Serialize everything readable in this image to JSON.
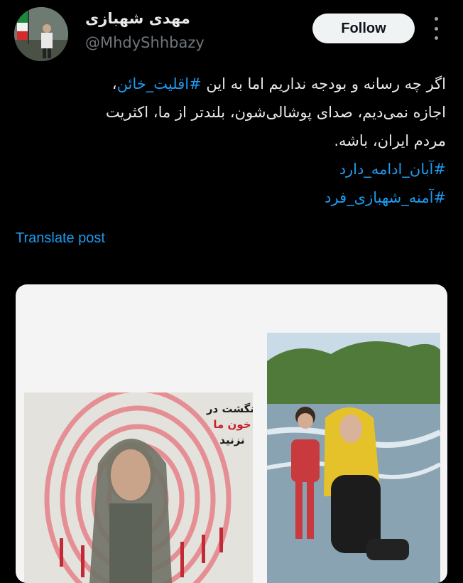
{
  "user": {
    "display_name": "مهدی شهبازی",
    "handle": "@MhdyShhbazy"
  },
  "follow_label": "Follow",
  "post": {
    "line1_pre": "اگر چه رسانه و بودجه نداریم اما به این ",
    "line1_tag": "#اقلیت_خائن",
    "line1_post": "،",
    "line2": "اجازه نمی‌دیم، صدای پوشالی‌شون، بلندتر از ما، اکثریت",
    "line3": "مردم ایران، باشه.",
    "hashtag1": "#آبان_ادامه_دارد",
    "hashtag2": "#آمنه_شهبازی_فرد"
  },
  "translate_label": "Translate post",
  "media": {
    "poster_line1": "انگشت در",
    "poster_line2": "خون ما",
    "poster_line3": "نزنید"
  },
  "colors": {
    "background": "#000000",
    "link": "#1d9bf0",
    "muted": "#71767b",
    "follow_bg": "#eff3f4"
  }
}
